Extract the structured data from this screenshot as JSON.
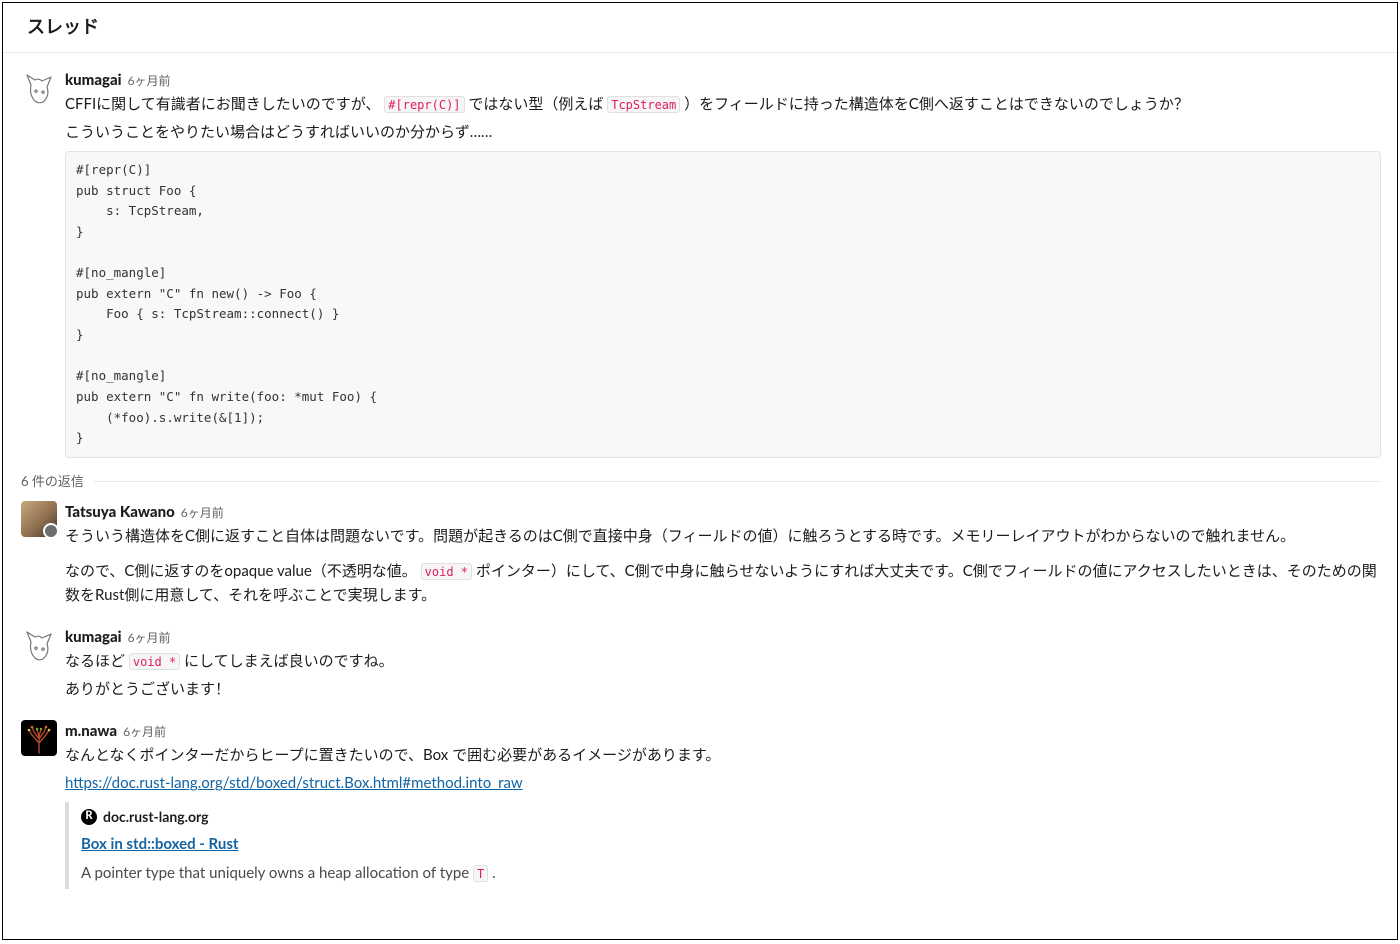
{
  "header": {
    "title": "スレッド"
  },
  "replies_label": "6 件の返信",
  "messages": [
    {
      "avatar": "cat",
      "name": "kumagai",
      "time": "6ヶ月前",
      "body_parts": [
        "CFFIに関して有識者にお聞きしたいのですが、",
        {
          "code": "#[repr(C)]"
        },
        " ではない型（例えば ",
        {
          "code": "TcpStream"
        },
        "）をフィールドに持った構造体をC側へ返すことはできないのでしょうか？"
      ],
      "body_line2": "こういうことをやりたい場合はどうすればいいのか分からず……",
      "code_block": "#[repr(C)]\npub struct Foo {\n    s: TcpStream,\n}\n\n#[no_mangle]\npub extern \"C\" fn new() -> Foo {\n    Foo { s: TcpStream::connect() }\n}\n\n#[no_mangle]\npub extern \"C\" fn write(foo: *mut Foo) {\n    (*foo).s.write(&[1]);\n}"
    },
    {
      "avatar": "photo",
      "name": "Tatsuya Kawano",
      "time": "6ヶ月前",
      "p1": "そういう構造体をC側に返すこと自体は問題ないです。問題が起きるのはC側で直接中身（フィールドの値）に触ろうとする時です。メモリーレイアウトがわからないので触れません。",
      "p2_parts": [
        "なので、C側に返すのをopaque value（不透明な値。",
        {
          "code": "void *"
        },
        " ポインター）にして、C側で中身に触らせないようにすれば大丈夫です。C側でフィールドの値にアクセスしたいときは、そのための関数をRust側に用意して、それを呼ぶことで実現します。"
      ]
    },
    {
      "avatar": "cat",
      "name": "kumagai",
      "time": "6ヶ月前",
      "p1_parts": [
        "なるほど ",
        {
          "code": "void *"
        },
        " にしてしまえば良いのですね。"
      ],
      "p2": "ありがとうございます！"
    },
    {
      "avatar": "tree",
      "name": "m.nawa",
      "time": "6ヶ月前",
      "p1": "なんとなくポインターだからヒープに置きたいので、Box で囲む必要があるイメージがあります。",
      "link_text": "https://doc.rust-lang.org/std/boxed/struct.Box.html#method.into_raw",
      "link_href": "https://doc.rust-lang.org/std/boxed/struct.Box.html#method.into_raw",
      "attachment": {
        "favicon_letter": "R",
        "site": "doc.rust-lang.org",
        "title": "Box in std::boxed - Rust",
        "title_href": "https://doc.rust-lang.org/std/boxed/struct.Box.html",
        "desc_parts": [
          "A pointer type that uniquely owns a heap allocation of type ",
          {
            "code": "T"
          },
          "."
        ]
      }
    }
  ]
}
